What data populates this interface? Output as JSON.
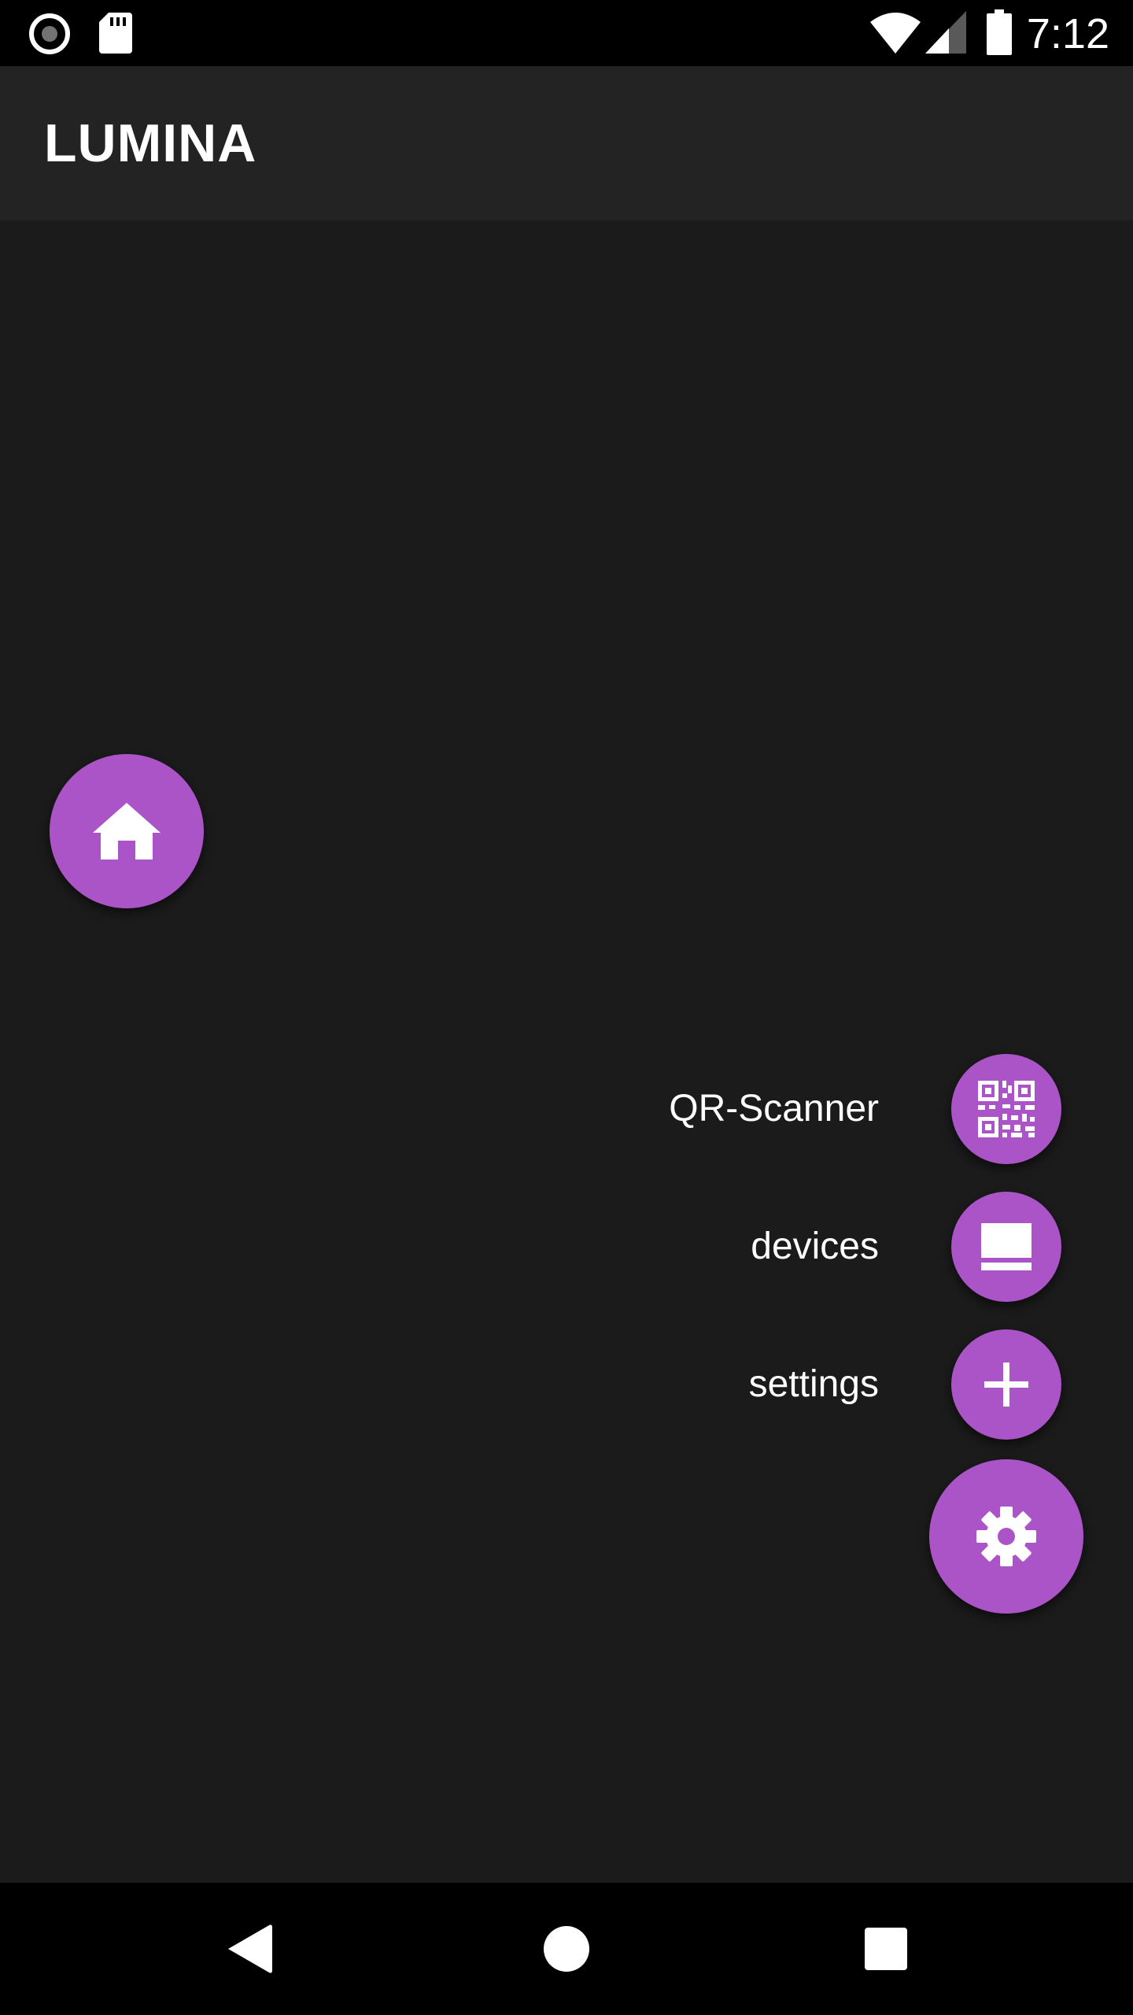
{
  "status_bar": {
    "time": "7:12",
    "icons": [
      "record-icon",
      "sd-card-icon",
      "wifi-icon",
      "cell-signal-icon",
      "battery-icon"
    ]
  },
  "app_bar": {
    "title": "LUMINA"
  },
  "fab_menu": {
    "items": [
      {
        "label": "QR-Scanner",
        "icon": "qr-code-icon"
      },
      {
        "label": "devices",
        "icon": "devices-icon"
      },
      {
        "label": "settings",
        "icon": "plus-icon"
      }
    ],
    "main_icon": "gear-icon"
  },
  "home_button": {
    "icon": "home-icon"
  },
  "nav_bar": {
    "icons": [
      "back-icon",
      "home-circle-icon",
      "recents-icon"
    ]
  },
  "colors": {
    "accent": "#ab54c8",
    "background": "#1b1b1c",
    "app_bar": "#232323",
    "status_bar": "#000000"
  }
}
